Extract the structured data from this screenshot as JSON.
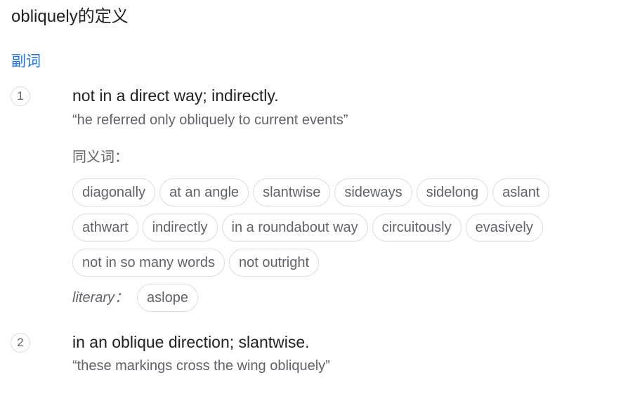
{
  "title": "obliquely的定义",
  "part_of_speech": "副词",
  "senses": [
    {
      "number": "1",
      "definition": "not in a direct way; indirectly.",
      "example": "“he referred only obliquely to current events”",
      "synonyms_label": "同义词：",
      "synonym_rows": [
        [
          "diagonally",
          "at an angle",
          "slantwise",
          "sideways",
          "sidelong",
          "aslant"
        ],
        [
          "athwart",
          "indirectly",
          "in a roundabout way",
          "circuitously",
          "evasively"
        ],
        [
          "not in so many words",
          "not outright"
        ]
      ],
      "literary_label": "literary：",
      "literary_synonyms": [
        "aslope"
      ]
    },
    {
      "number": "2",
      "definition": "in an oblique direction; slantwise.",
      "example": "“these markings cross the wing obliquely”"
    }
  ]
}
